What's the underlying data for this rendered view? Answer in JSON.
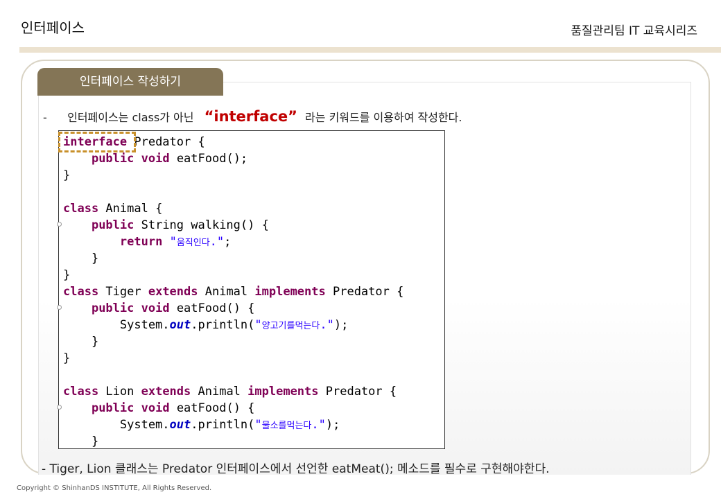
{
  "header": {
    "title": "인터페이스",
    "series": "품질관리팀 IT 교육시리즈"
  },
  "section": {
    "tab_label": "인터페이스 작성하기"
  },
  "bullet": {
    "dash": "-",
    "prefix": "인터페이스는 class가 아닌",
    "keyword": "“interface”",
    "suffix": "라는 키워드를 이용하여 작성한다."
  },
  "code": {
    "lines": [
      [
        {
          "t": "k",
          "v": "interface"
        },
        {
          "t": "n",
          "v": " Predator {"
        }
      ],
      [
        {
          "t": "n",
          "v": "    "
        },
        {
          "t": "k",
          "v": "public"
        },
        {
          "t": "n",
          "v": " "
        },
        {
          "t": "k",
          "v": "void"
        },
        {
          "t": "n",
          "v": " eatFood();"
        }
      ],
      [
        {
          "t": "n",
          "v": "}"
        }
      ],
      [
        {
          "t": "n",
          "v": ""
        }
      ],
      [
        {
          "t": "k",
          "v": "class"
        },
        {
          "t": "n",
          "v": " Animal {"
        }
      ],
      [
        {
          "t": "n",
          "v": "    "
        },
        {
          "t": "k",
          "v": "public"
        },
        {
          "t": "n",
          "v": " String walking() {"
        }
      ],
      [
        {
          "t": "n",
          "v": "        "
        },
        {
          "t": "k",
          "v": "return"
        },
        {
          "t": "n",
          "v": " "
        },
        {
          "t": "s",
          "v": "\""
        },
        {
          "t": "ks",
          "v": "움직인다"
        },
        {
          "t": "s",
          "v": ".\""
        },
        {
          "t": "n",
          "v": ";"
        }
      ],
      [
        {
          "t": "n",
          "v": "    }"
        }
      ],
      [
        {
          "t": "n",
          "v": "}"
        }
      ],
      [
        {
          "t": "k",
          "v": "class"
        },
        {
          "t": "n",
          "v": " Tiger "
        },
        {
          "t": "k",
          "v": "extends"
        },
        {
          "t": "n",
          "v": " Animal "
        },
        {
          "t": "k",
          "v": "implements"
        },
        {
          "t": "n",
          "v": " Predator {"
        }
      ],
      [
        {
          "t": "n",
          "v": "    "
        },
        {
          "t": "k",
          "v": "public"
        },
        {
          "t": "n",
          "v": " "
        },
        {
          "t": "k",
          "v": "void"
        },
        {
          "t": "n",
          "v": " eatFood() {"
        }
      ],
      [
        {
          "t": "n",
          "v": "        System."
        },
        {
          "t": "f",
          "v": "out"
        },
        {
          "t": "n",
          "v": ".println("
        },
        {
          "t": "s",
          "v": "\""
        },
        {
          "t": "ks",
          "v": "양고기를먹는다"
        },
        {
          "t": "s",
          "v": ".\""
        },
        {
          "t": "n",
          "v": ");"
        }
      ],
      [
        {
          "t": "n",
          "v": "    }"
        }
      ],
      [
        {
          "t": "n",
          "v": "}"
        }
      ],
      [
        {
          "t": "n",
          "v": ""
        }
      ],
      [
        {
          "t": "k",
          "v": "class"
        },
        {
          "t": "n",
          "v": " Lion "
        },
        {
          "t": "k",
          "v": "extends"
        },
        {
          "t": "n",
          "v": " Animal "
        },
        {
          "t": "k",
          "v": "implements"
        },
        {
          "t": "n",
          "v": " Predator {"
        }
      ],
      [
        {
          "t": "n",
          "v": "    "
        },
        {
          "t": "k",
          "v": "public"
        },
        {
          "t": "n",
          "v": " "
        },
        {
          "t": "k",
          "v": "void"
        },
        {
          "t": "n",
          "v": " eatFood() {"
        }
      ],
      [
        {
          "t": "n",
          "v": "        System."
        },
        {
          "t": "f",
          "v": "out"
        },
        {
          "t": "n",
          "v": ".println("
        },
        {
          "t": "s",
          "v": "\""
        },
        {
          "t": "ks",
          "v": "물소를먹는다"
        },
        {
          "t": "s",
          "v": ".\""
        },
        {
          "t": "n",
          "v": ");"
        }
      ],
      [
        {
          "t": "n",
          "v": "    }"
        }
      ]
    ]
  },
  "footer_note": "- Tiger, Lion 클래스는 Predator 인터페이스에서 선언한 eatMeat(); 메소드를 필수로 구현해야한다.",
  "copyright": "Copyright © ShinhanDS INSTITUTE, All Rights Reserved.",
  "colors": {
    "accent_tab": "#847556",
    "keyword_red": "#c00000",
    "java_keyword": "#7f0055",
    "java_string": "#2a00ff",
    "java_field": "#0000c0",
    "highlight_dash": "#c8902a"
  }
}
